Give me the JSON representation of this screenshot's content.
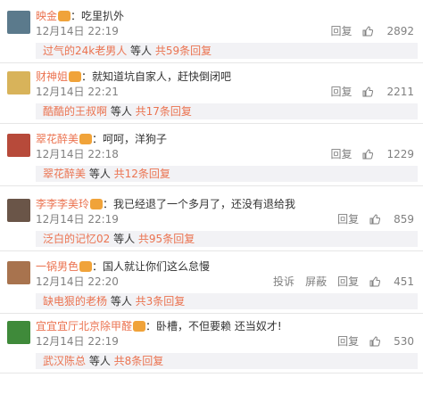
{
  "comments": [
    {
      "user": "映金",
      "sep": "：",
      "text": "吃里扒外",
      "date": "12月14日 22:19",
      "actions": [
        "回复"
      ],
      "likes": "2892",
      "reply": {
        "name": "过气的24k老男人",
        "mid": " 等人 ",
        "count": "共59条回复"
      },
      "avatar_color": "#5b7a8c"
    },
    {
      "user": "财神姐",
      "sep": "：",
      "text": "就知道坑自家人，赶快倒闭吧",
      "date": "12月14日 22:21",
      "actions": [
        "回复"
      ],
      "likes": "2211",
      "reply": {
        "name": "酷酷的王叔啊",
        "mid": " 等人 ",
        "count": "共17条回复"
      },
      "avatar_color": "#d8b35a"
    },
    {
      "user": "翠花醉美",
      "sep": "：",
      "text": "呵呵，洋狗子",
      "date": "12月14日 22:18",
      "actions": [
        "回复"
      ],
      "likes": "1229",
      "reply": {
        "name": "翠花醉美",
        "mid": " 等人 ",
        "count": "共12条回复"
      },
      "avatar_color": "#b74a3a"
    },
    {
      "user": "李李李美玲",
      "sep": "：",
      "text": "我已经退了一个多月了，还没有退给我",
      "date": "12月14日 22:19",
      "actions": [
        "回复"
      ],
      "likes": "859",
      "reply": {
        "name": "泛白的记忆02",
        "mid": " 等人 ",
        "count": "共95条回复"
      },
      "avatar_color": "#6a5548"
    },
    {
      "user": "一锅男色",
      "sep": "：",
      "text": "国人就让你们这么怠慢",
      "date": "12月14日 22:20",
      "actions": [
        "投诉",
        "屏蔽",
        "回复"
      ],
      "likes": "451",
      "reply": {
        "name": "缺电狠的老杨",
        "mid": " 等人 ",
        "count": "共3条回复"
      },
      "avatar_color": "#a8734e"
    },
    {
      "user": "宜宜宜厅北京除甲醛",
      "sep": "：",
      "text": "卧槽，不但要赖 还当奴才!",
      "date": "12月14日 22:19",
      "actions": [
        "回复"
      ],
      "likes": "530",
      "reply": {
        "name": "武汉陈总",
        "mid": " 等人 ",
        "count": "共8条回复"
      },
      "avatar_color": "#3f8a3a"
    }
  ],
  "colors": {
    "username": "#eb7350",
    "meta": "#808080",
    "reply_bg": "#f2f2f5"
  }
}
